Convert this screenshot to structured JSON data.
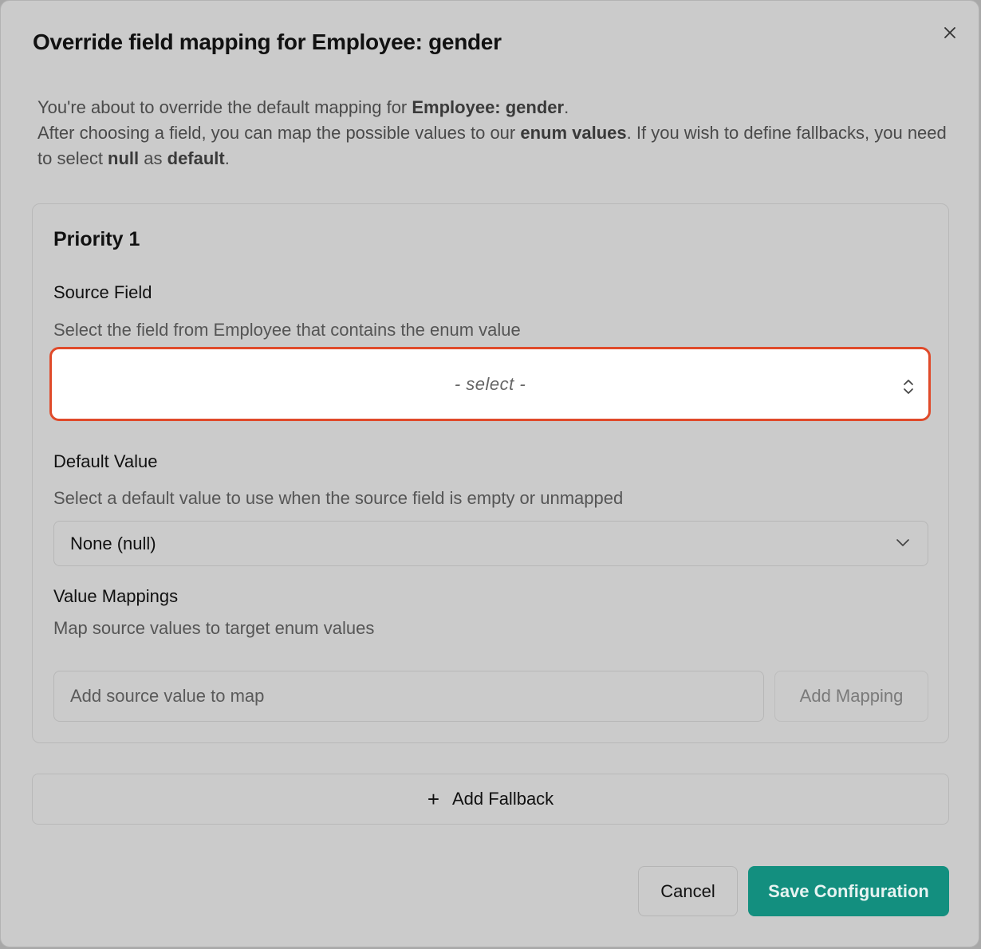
{
  "dialog": {
    "title": "Override field mapping for Employee: gender",
    "intro": {
      "line1_prefix": "You're about to override the default mapping for ",
      "line1_bold": "Employee: gender",
      "line1_suffix": ".",
      "line2_prefix": "After choosing a field, you can map the possible values to our ",
      "line2_bold": "enum values",
      "line2_mid": ". If you wish to define fallbacks, you need to select ",
      "line2_bold2": "null",
      "line2_mid2": " as ",
      "line2_bold3": "default",
      "line2_suffix": "."
    }
  },
  "priority": {
    "title": "Priority 1",
    "source_field": {
      "label": "Source Field",
      "description": "Select the field from Employee that contains the enum value",
      "placeholder": "- select -"
    },
    "default_value": {
      "label": "Default Value",
      "description": "Select a default value to use when the source field is empty or unmapped",
      "selected": "None (null)"
    },
    "value_mappings": {
      "label": "Value Mappings",
      "description": "Map source values to target enum values",
      "input_placeholder": "Add source value to map",
      "add_button": "Add Mapping"
    }
  },
  "add_fallback": {
    "icon": "plus-icon",
    "label": "Add Fallback"
  },
  "footer": {
    "cancel": "Cancel",
    "save": "Save Configuration"
  },
  "colors": {
    "highlight": "#e04a2a",
    "primary": "#138f7f"
  }
}
